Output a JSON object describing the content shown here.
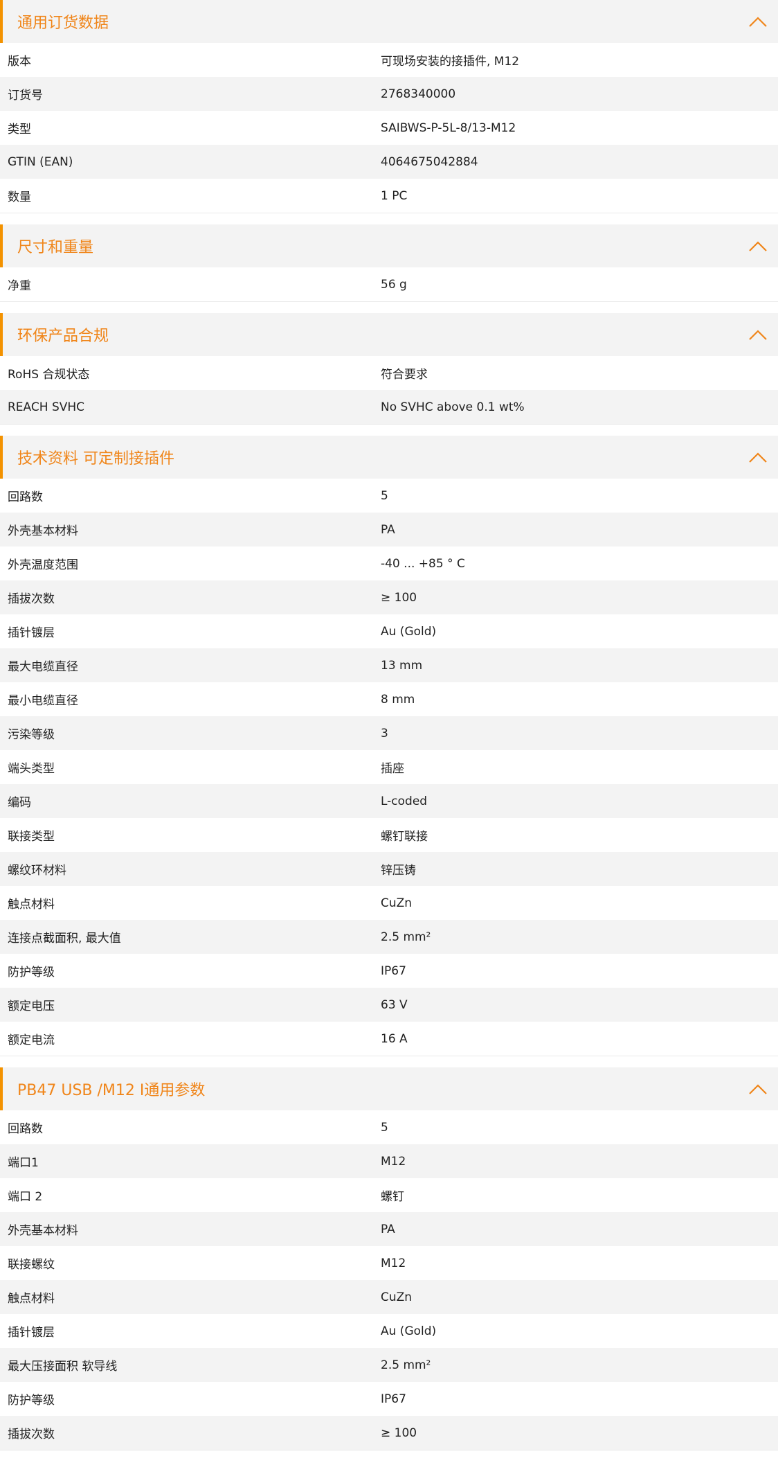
{
  "accent_color": "#f08519",
  "collapse_icon": "chevron-up-icon",
  "sections": [
    {
      "title": "通用订货数据",
      "rows": [
        {
          "label": "版本",
          "value": "可现场安装的接插件, M12"
        },
        {
          "label": "订货号",
          "value": "2768340000"
        },
        {
          "label": "类型",
          "value": "SAIBWS-P-5L-8/13-M12"
        },
        {
          "label": "GTIN (EAN)",
          "value": "4064675042884"
        },
        {
          "label": "数量",
          "value": "1  PC"
        }
      ]
    },
    {
      "title": "尺寸和重量",
      "rows": [
        {
          "label": "净重",
          "value": "56  g"
        }
      ]
    },
    {
      "title": "环保产品合规",
      "rows": [
        {
          "label": "RoHS 合规状态",
          "value": "符合要求"
        },
        {
          "label": "REACH SVHC",
          "value": "No SVHC above 0.1 wt%"
        }
      ]
    },
    {
      "title": "技术资料 可定制接插件",
      "rows": [
        {
          "label": "回路数",
          "value": "5"
        },
        {
          "label": "外壳基本材料",
          "value": "PA"
        },
        {
          "label": "外壳温度范围",
          "value": "-40 ... +85 ° C"
        },
        {
          "label": "插拔次数",
          "value": "≥ 100"
        },
        {
          "label": "插针镀层",
          "value": "Au (Gold)"
        },
        {
          "label": "最大电缆直径",
          "value": "13  mm"
        },
        {
          "label": "最小电缆直径",
          "value": "8  mm"
        },
        {
          "label": "污染等级",
          "value": "3"
        },
        {
          "label": "端头类型",
          "value": "插座"
        },
        {
          "label": "编码",
          "value": "L-coded"
        },
        {
          "label": "联接类型",
          "value": "螺钉联接"
        },
        {
          "label": "螺纹环材料",
          "value": "锌压铸"
        },
        {
          "label": "触点材料",
          "value": "CuZn"
        },
        {
          "label": "连接点截面积, 最大值",
          "value": "2.5  mm²"
        },
        {
          "label": "防护等级",
          "value": "IP67"
        },
        {
          "label": "额定电压",
          "value": "63  V"
        },
        {
          "label": "额定电流",
          "value": "16  A"
        }
      ]
    },
    {
      "title": "PB47 USB /M12 I通用参数",
      "rows": [
        {
          "label": "回路数",
          "value": "5"
        },
        {
          "label": "端口1",
          "value": "M12"
        },
        {
          "label": "端口 2",
          "value": "螺钉"
        },
        {
          "label": "外壳基本材料",
          "value": "PA"
        },
        {
          "label": "联接螺纹",
          "value": "M12"
        },
        {
          "label": "触点材料",
          "value": "CuZn"
        },
        {
          "label": "插针镀层",
          "value": "Au (Gold)"
        },
        {
          "label": "最大压接面积 软导线",
          "value": "2.5  mm²"
        },
        {
          "label": "防护等级",
          "value": "IP67"
        },
        {
          "label": "插拔次数",
          "value": "≥ 100"
        }
      ]
    }
  ]
}
